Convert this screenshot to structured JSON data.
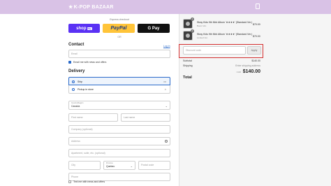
{
  "header": {
    "logo": "K-POP BAZAAR"
  },
  "express": {
    "label": "Express checkout",
    "shop_pay": "shop",
    "shop_pay_tag": "Pay",
    "paypal": "PayPal",
    "gpay": "G Pay",
    "or": "OR"
  },
  "contact": {
    "title": "Contact",
    "login": "Log in",
    "email_placeholder": "Email",
    "news_label": "Email me with news and offers"
  },
  "delivery": {
    "title": "Delivery",
    "ship_label": "Ship",
    "pickup_label": "Pickup in store",
    "country_label": "Country/Region",
    "country_value": "Canada",
    "first_name": "First name",
    "last_name": "Last name",
    "company": "Company (optional)",
    "address": "Address",
    "apartment": "Apartment, suite, etc. (optional)",
    "city": "City",
    "province_label": "Province",
    "province_value": "Quebec",
    "postal": "Postal code",
    "phone": "Phone",
    "text_label": "Text me with news and offers"
  },
  "cart": {
    "items": [
      {
        "qty": "1",
        "name": "Stray Kids 9th Mini Album '★★★★' (Standard Ver.)",
        "variant": "Boom Ver.",
        "price": "$70.00"
      },
      {
        "qty": "1",
        "name": "Stray Kids 9th Mini Album '★★★★' (Standard Ver.)",
        "variant": "Limited Ver.",
        "price": "$70.00"
      }
    ],
    "discount_placeholder": "Discount code",
    "apply": "Apply",
    "subtotal_label": "Subtotal",
    "subtotal_value": "$140.00",
    "shipping_label": "Shipping",
    "shipping_value": "Enter shipping address",
    "total_label": "Total",
    "total_currency": "CAD",
    "total_value": "$140.00"
  }
}
